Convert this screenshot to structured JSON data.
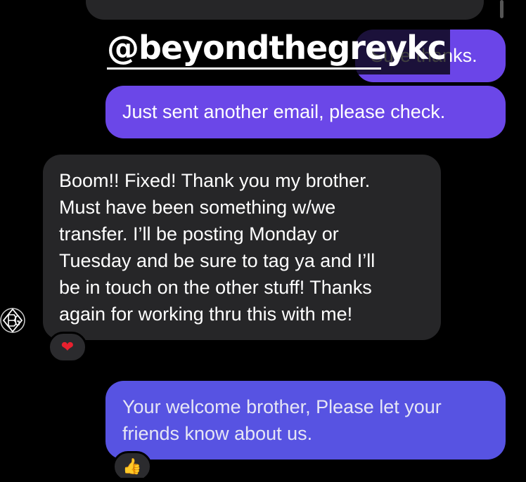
{
  "conversation": {
    "overlay": {
      "handle": "@beyondthegreykc"
    },
    "messages": [
      {
        "id": "sure",
        "direction": "sent",
        "text": "Sure thanks."
      },
      {
        "id": "sent_email",
        "direction": "sent",
        "text": "Just sent another email, please check."
      },
      {
        "id": "boom",
        "direction": "received",
        "lines": [
          "Boom!! Fixed! Thank you my brother.",
          "Must have been something w/we",
          "transfer. I’ll be posting Monday or",
          "Tuesday and be sure to tag ya and I’ll",
          "be in touch on the other stuff! Thanks",
          "again for working thru this with me!"
        ],
        "reaction": "❤"
      },
      {
        "id": "welcome",
        "direction": "sent",
        "lines": [
          "Your welcome brother, Please let your",
          "friends know about us."
        ],
        "reaction": "👍"
      }
    ]
  },
  "colors": {
    "background": "#000000",
    "sent_bubble": "#6b45e8",
    "received_bubble": "#262628",
    "heart": "#e8202e"
  },
  "icons": {
    "avatar": "bg-monogram-logo-icon",
    "heart_reaction": "heart-icon",
    "thumbs_reaction": "thumbs-up-icon"
  }
}
